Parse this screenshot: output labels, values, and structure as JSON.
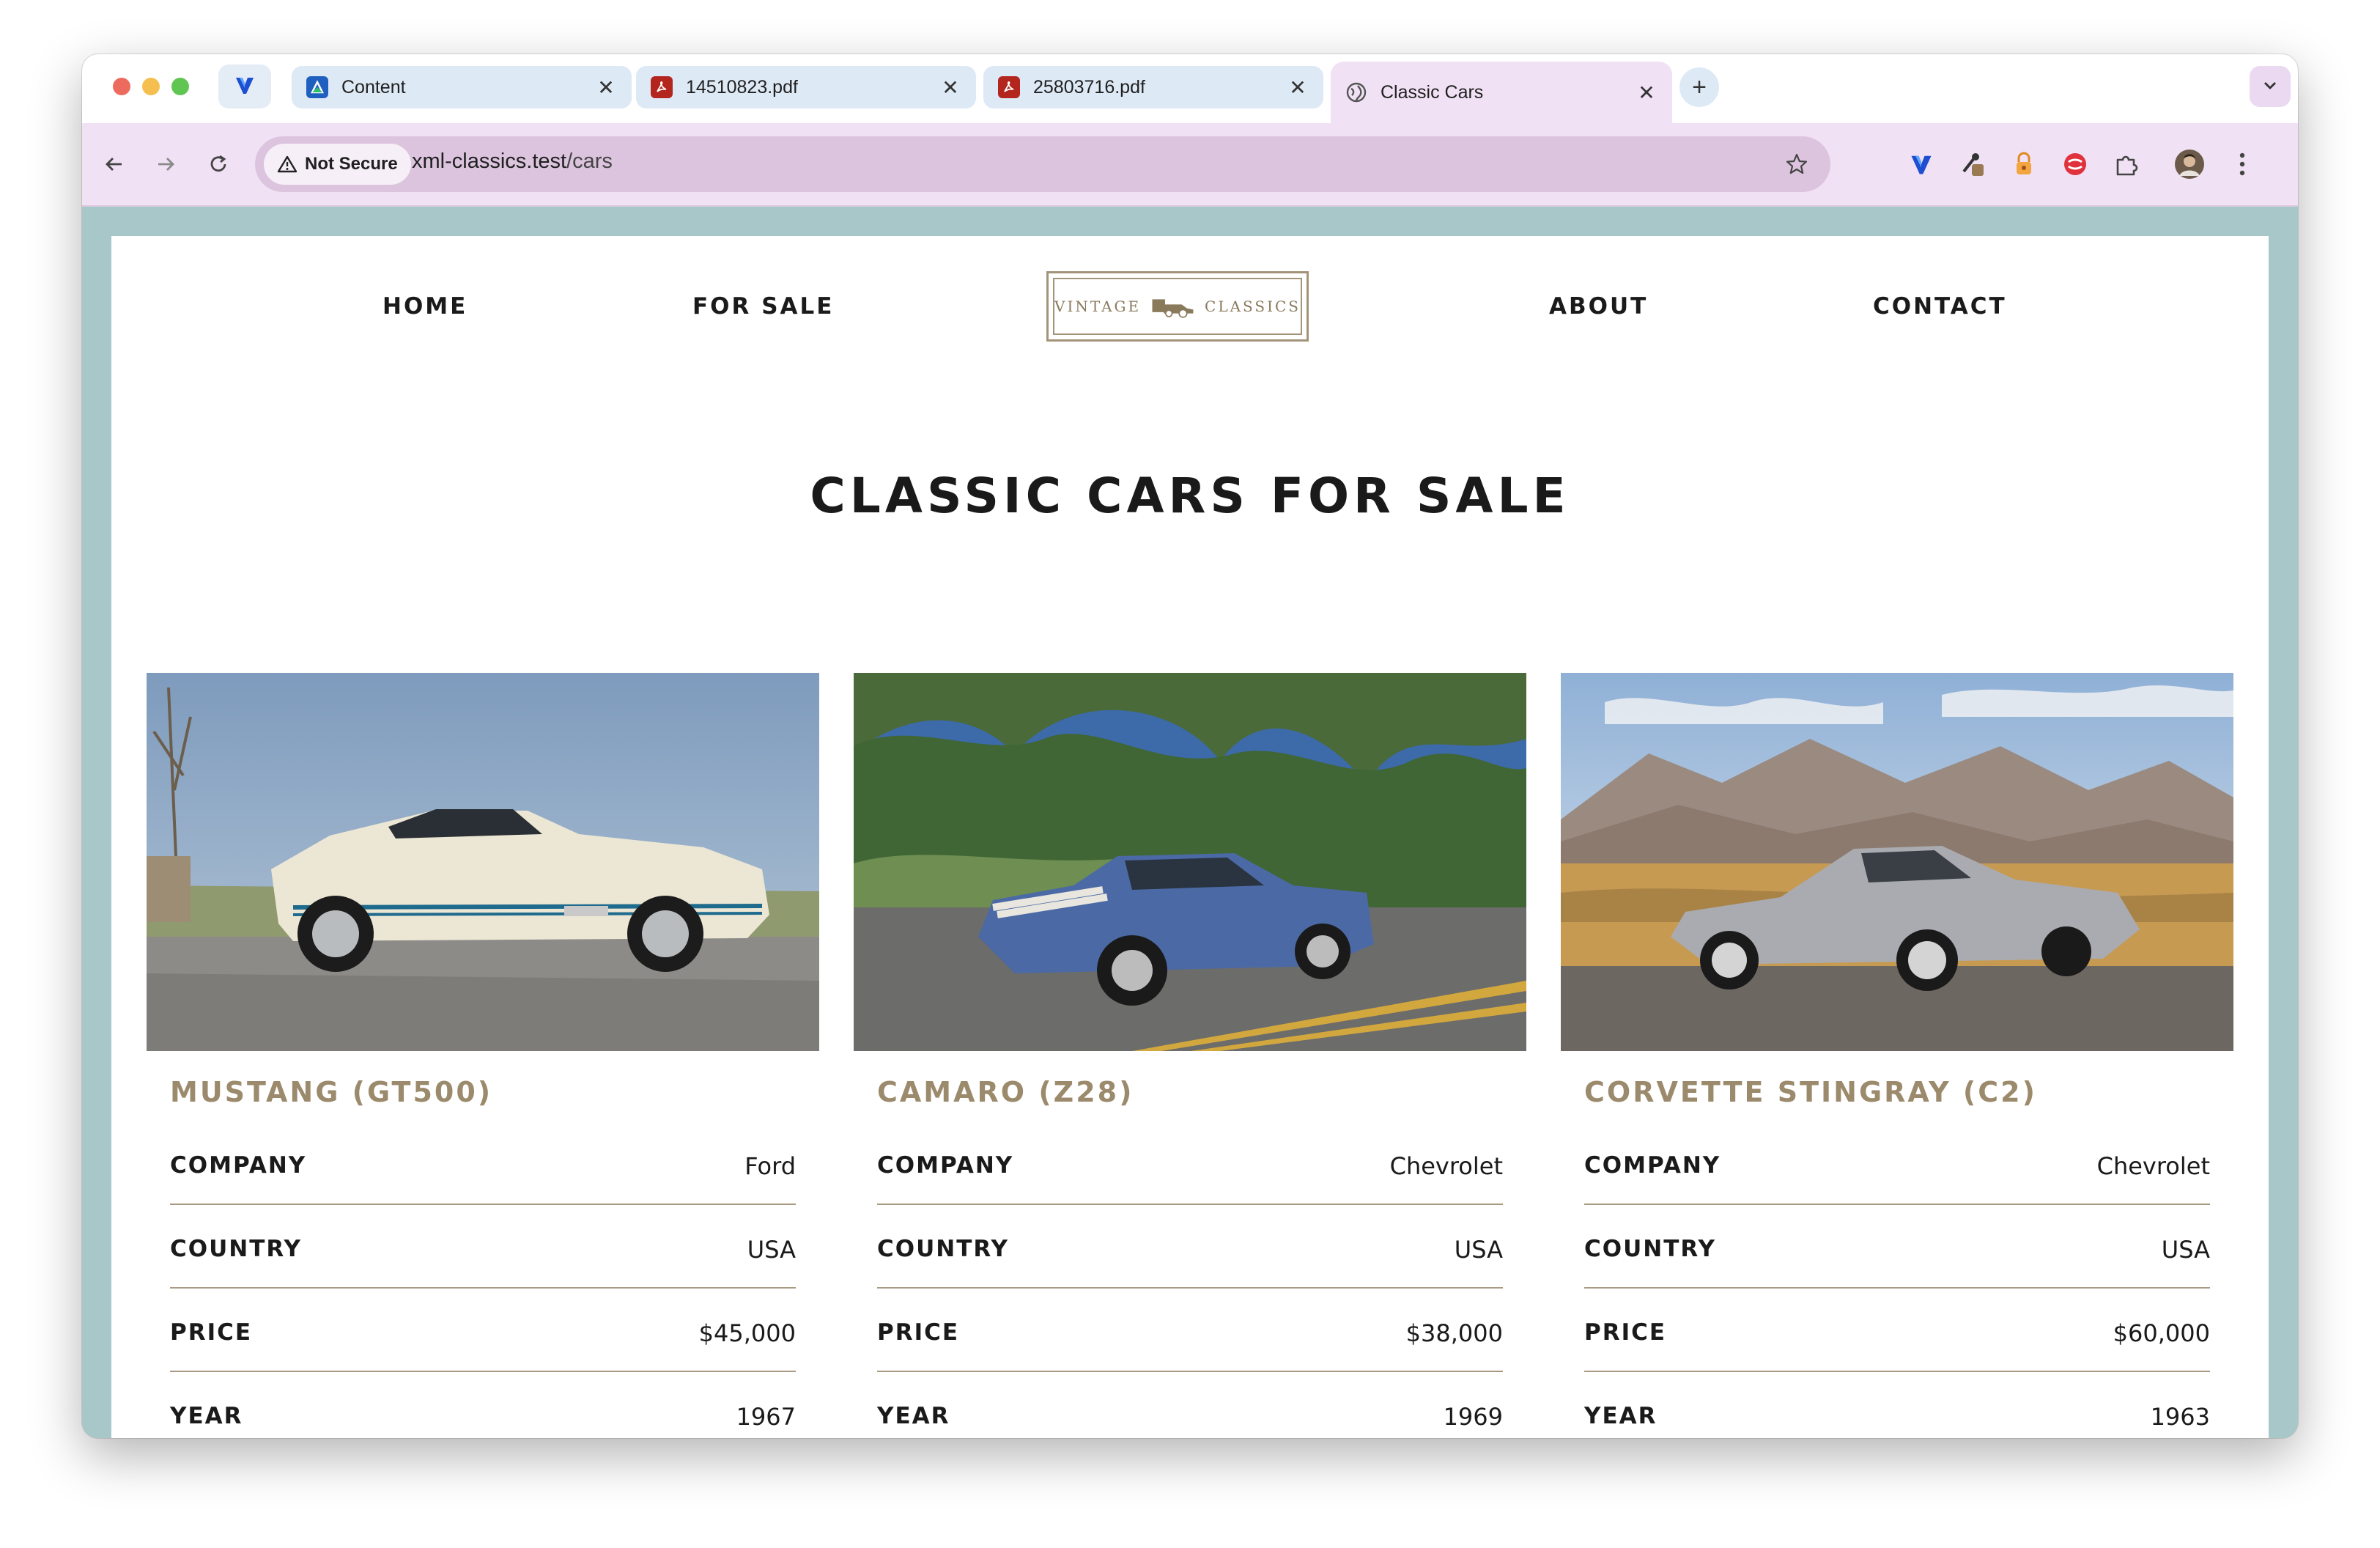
{
  "browser": {
    "tabs": [
      {
        "title": "Content",
        "favicon": "content-app-icon",
        "active": false
      },
      {
        "title": "14510823.pdf",
        "favicon": "pdf-icon",
        "active": false
      },
      {
        "title": "25803716.pdf",
        "favicon": "pdf-icon",
        "active": false
      },
      {
        "title": "Classic Cars",
        "favicon": "globe-icon",
        "active": true
      }
    ],
    "security_label": "Not Secure",
    "url_host": "xml-classics.test",
    "url_path": "/cars",
    "colors": {
      "toolbar": "#f1e1f4",
      "omnibox": "#dcc4de",
      "inactive_tab": "#dde9f5"
    }
  },
  "site": {
    "nav": {
      "home": "HOME",
      "for_sale": "FOR SALE",
      "about": "ABOUT",
      "contact": "CONTACT"
    },
    "logo": {
      "left": "VINTAGE",
      "right": "CLASSICS"
    },
    "headline": "CLASSIC CARS FOR SALE",
    "colors": {
      "frame": "#a8c7c8",
      "accent": "#9b8a6c",
      "divider": "#a89b82"
    }
  },
  "labels": {
    "company": "COMPANY",
    "country": "COUNTRY",
    "price": "PRICE",
    "year": "YEAR"
  },
  "cars": [
    {
      "name": "MUSTANG (GT500)",
      "company": "Ford",
      "country": "USA",
      "price": "$45,000",
      "year": "1967"
    },
    {
      "name": "CAMARO (Z28)",
      "company": "Chevrolet",
      "country": "USA",
      "price": "$38,000",
      "year": "1969"
    },
    {
      "name": "CORVETTE STINGRAY (C2)",
      "company": "Chevrolet",
      "country": "USA",
      "price": "$60,000",
      "year": "1963"
    }
  ]
}
